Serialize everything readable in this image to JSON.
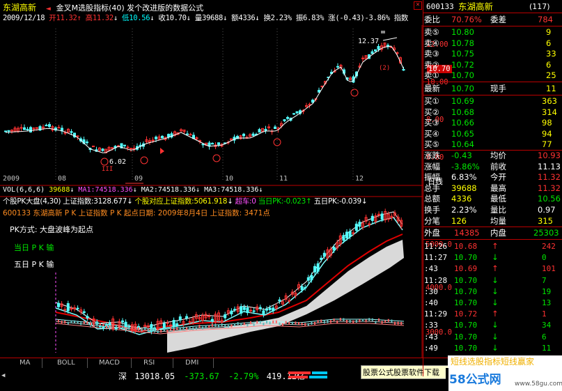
{
  "header": {
    "stock_name": "东湖高新",
    "indicator": "金叉M选股指标(40) 发个改进版的数据公式",
    "date": "2009/12/18",
    "open": "开11.32",
    "high": "高11.32",
    "low": "低10.56",
    "close": "收10.70",
    "volume": "量39688",
    "amount": "额4336",
    "turnover": "换2.23%",
    "amplitude": "振6.83%",
    "change": "涨(-0.43)-3.86%",
    "idx_btn": "指数"
  },
  "main_chart": {
    "price_ticks": [
      "12.00",
      "10.00",
      "8.00",
      "6.00"
    ],
    "current_price": "10.70",
    "high_annot": "12.37",
    "low_annot": "6.02",
    "month_labels": [
      "2009",
      "08",
      "09",
      "10",
      "11",
      "12"
    ],
    "period": "日线",
    "markers": [
      "III",
      "(2)"
    ]
  },
  "vol_bar": {
    "label": "VOL(6,6,6)",
    "v1": "39688",
    "ma1": "MA1:74518.336",
    "ma2": "MA2:74518.336",
    "ma3": "MA3:74518.336"
  },
  "pk": {
    "title": "个股PK大盘(4,30)",
    "idx": "上证指数:3128.677",
    "corr": "个股对应上证指数:5061.918",
    "over": "超车:0",
    "today": "当日PK:-0.023",
    "five": "五日PK:-0.039",
    "info": "600133 东湖高新 P K 上证指数 P K 起点日期: 2009年8月4日 上证指数: 3471点",
    "mode": "PK方式: 大盘波峰为起点",
    "today_res": "当日 P K 输",
    "five_res": "五日 P K 输",
    "ticks": [
      "5000.0",
      "4000.0",
      "3000.0"
    ]
  },
  "tabs": [
    "MA",
    "BOLL",
    "MACD",
    "RSI",
    "DMI"
  ],
  "status": {
    "market": "深",
    "value": "13018.05",
    "chg": "-373.67",
    "pct": "-2.79%",
    "amt": "419.12亿",
    "ad1": "股票公式股票软件下载",
    "ad2": "短线选股指标短线赢家",
    "site": "58公式网",
    "url": "www.58gu.com"
  },
  "right_panel": {
    "code": "600133",
    "name": "东湖高新",
    "num": "(117)",
    "weibi_label": "委比",
    "weibi": "70.76%",
    "weicha_label": "委差",
    "weicha": "784",
    "sells": [
      {
        "label": "卖⑤",
        "price": "10.80",
        "vol": "9"
      },
      {
        "label": "卖④",
        "price": "10.78",
        "vol": "6"
      },
      {
        "label": "卖③",
        "price": "10.75",
        "vol": "33"
      },
      {
        "label": "卖②",
        "price": "10.72",
        "vol": "6"
      },
      {
        "label": "卖①",
        "price": "10.70",
        "vol": "25"
      }
    ],
    "latest_label": "最新",
    "latest": "10.70",
    "cur_label": "现手",
    "cur": "11",
    "buys": [
      {
        "label": "买①",
        "price": "10.69",
        "vol": "363"
      },
      {
        "label": "买②",
        "price": "10.68",
        "vol": "314"
      },
      {
        "label": "买③",
        "price": "10.66",
        "vol": "98"
      },
      {
        "label": "买④",
        "price": "10.65",
        "vol": "94"
      },
      {
        "label": "买⑤",
        "price": "10.64",
        "vol": "77"
      }
    ],
    "stats": [
      {
        "l1": "涨跌",
        "v1": "-0.43",
        "l2": "均价",
        "v2": "10.93"
      },
      {
        "l1": "涨幅",
        "v1": "-3.86%",
        "l2": "前收",
        "v2": "11.13"
      },
      {
        "l1": "振幅",
        "v1": "6.83%",
        "l2": "今开",
        "v2": "11.32"
      },
      {
        "l1": "总手",
        "v1": "39688",
        "l2": "最高",
        "v2": "11.32"
      },
      {
        "l1": "总额",
        "v1": "4336",
        "l2": "最低",
        "v2": "10.56"
      },
      {
        "l1": "换手",
        "v1": "2.23%",
        "l2": "量比",
        "v2": "0.97"
      },
      {
        "l1": "分笔",
        "v1": "126",
        "l2": "均量",
        "v2": "315"
      }
    ],
    "outer_label": "外盘",
    "outer": "14385",
    "inner_label": "内盘",
    "inner": "25303",
    "ticks": [
      {
        "t": "11:26",
        "p": "10.68",
        "a": "↑",
        "v": "242"
      },
      {
        "t": "11:27",
        "p": "10.70",
        "a": "↓",
        "v": "0"
      },
      {
        "t": ":43",
        "p": "10.69",
        "a": "↑",
        "v": "101"
      },
      {
        "t": "11:28",
        "p": "10.70",
        "a": "↓",
        "v": "7"
      },
      {
        "t": ":30",
        "p": "10.70",
        "a": "↓",
        "v": "19"
      },
      {
        "t": ":40",
        "p": "10.70",
        "a": "↓",
        "v": "13"
      },
      {
        "t": "11:29",
        "p": "10.72",
        "a": "↑",
        "v": "1"
      },
      {
        "t": ":33",
        "p": "10.70",
        "a": "↓",
        "v": "34"
      },
      {
        "t": ":43",
        "p": "10.70",
        "a": "↓",
        "v": "6"
      },
      {
        "t": ":49",
        "p": "10.70",
        "a": "↓",
        "v": "11"
      }
    ]
  }
}
